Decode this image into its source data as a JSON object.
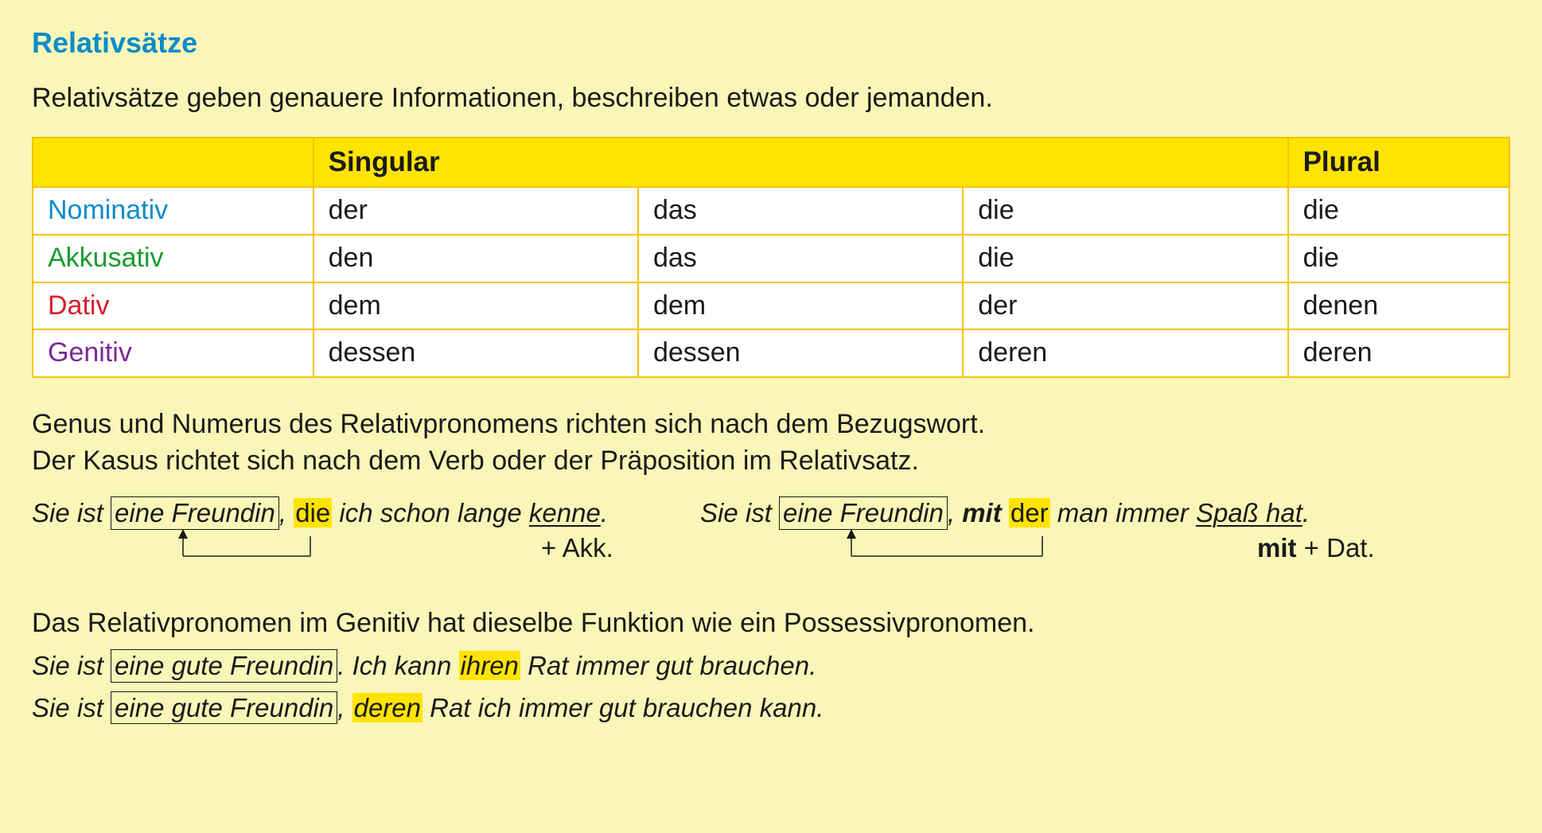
{
  "title": "Relativsätze",
  "intro": "Relativsätze geben genauere Informationen, beschreiben etwas oder jemanden.",
  "table": {
    "headers": {
      "singular": "Singular",
      "plural": "Plural"
    },
    "cases": {
      "nom": {
        "label": "Nominativ",
        "color": "#0a8ccb"
      },
      "akk": {
        "label": "Akkusativ",
        "color": "#1a9b2f"
      },
      "dat": {
        "label": "Dativ",
        "color": "#d81e2c"
      },
      "gen": {
        "label": "Genitiv",
        "color": "#7a2a9a"
      }
    },
    "cells": {
      "nom": [
        "der",
        "das",
        "die",
        "die"
      ],
      "akk": [
        "den",
        "das",
        "die",
        "die"
      ],
      "dat": [
        "dem",
        "dem",
        "der",
        "denen"
      ],
      "gen": [
        "dessen",
        "dessen",
        "deren",
        "deren"
      ]
    },
    "bold_cells": {
      "dat": [
        false,
        false,
        false,
        true
      ],
      "gen": [
        true,
        true,
        true,
        true
      ]
    }
  },
  "rule1_line1": "Genus und Numerus des Relativpronomens richten sich nach dem Bezugswort.",
  "rule1_line2": "Der Kasus richtet sich nach dem Verb oder der Präposition im Relativsatz.",
  "example1": {
    "prefix": "Sie ist",
    "boxed": "eine Freundin",
    "sep": ",",
    "hl": "die",
    "mid": "ich schon lange",
    "verb": "kenne",
    "end": ".",
    "anno": "+ Akk."
  },
  "example2": {
    "prefix": "Sie ist",
    "boxed": "eine Freundin",
    "sep": ",",
    "mit_word": "mit",
    "hl": "der",
    "mid": "man immer",
    "noun": "Spaß hat",
    "end": ".",
    "anno_bold": "mit",
    "anno_rest": " + Dat."
  },
  "rule2": "Das Relativpronomen im Genitiv hat dieselbe Funktion wie ein Possessivpronomen.",
  "example3": {
    "prefix": "Sie ist",
    "boxed": "eine gute Freundin",
    "sep": ". Ich kann",
    "hl": "ihren",
    "rest": "Rat immer gut brauchen."
  },
  "example4": {
    "prefix": "Sie ist",
    "boxed": "eine gute Freundin",
    "sep": ",",
    "hl": "deren",
    "rest": "Rat ich immer gut brauchen kann."
  }
}
